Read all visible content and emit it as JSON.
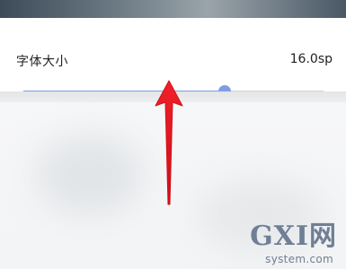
{
  "setting": {
    "label": "字体大小",
    "value_text": "16.0sp"
  },
  "slider": {
    "level": 0.67,
    "accent_color": "#7f9ee2"
  },
  "annotation": {
    "arrow_icon": "red-up-arrow-icon",
    "color": "#e0141a"
  },
  "watermark": {
    "main": "GXI网",
    "sub": "system.com"
  }
}
